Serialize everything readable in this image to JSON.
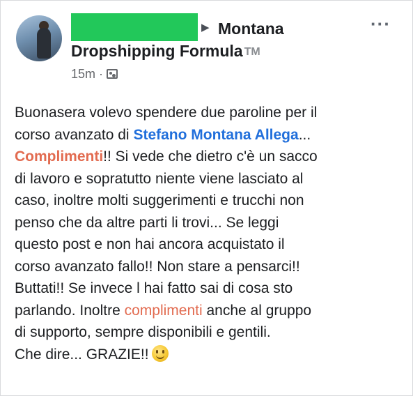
{
  "post": {
    "group_name_line1": "Montana",
    "group_name_line2": "Dropshipping Formula",
    "trademark": "TM",
    "timestamp": "15m",
    "separator": "·",
    "more_label": "···",
    "audience_icon": "group-icon",
    "body": {
      "l1": "Buonasera volevo spendere due paroline per il",
      "l2_pre": "corso avanzato di ",
      "l2_mention": "Stefano Montana Allega",
      "l2_post": "...",
      "l3_hl": "Complimenti",
      "l3_post": "!! Si vede che dietro c'è un sacco",
      "l4": "di lavoro e sopratutto niente viene lasciato al",
      "l5": "caso, inoltre molti suggerimenti e trucchi  non",
      "l6": "penso che da altre parti li trovi... Se leggi",
      "l7": "questo post e non hai ancora acquistato il",
      "l8": "corso avanzato fallo!! Non stare a pensarci!!",
      "l9": "Buttati!! Se invece l hai fatto sai di cosa sto",
      "l10_pre": "parlando. Inoltre ",
      "l10_hl": "complimenti",
      "l10_post": " anche al gruppo",
      "l11": "di supporto, sempre disponibili e gentili.",
      "l12": "Che dire... GRAZIE!!",
      "emoji": "smiley-emoji"
    }
  },
  "colors": {
    "mention": "#216fdb",
    "highlight": "#e26b50",
    "redaction": "#22c85a"
  }
}
